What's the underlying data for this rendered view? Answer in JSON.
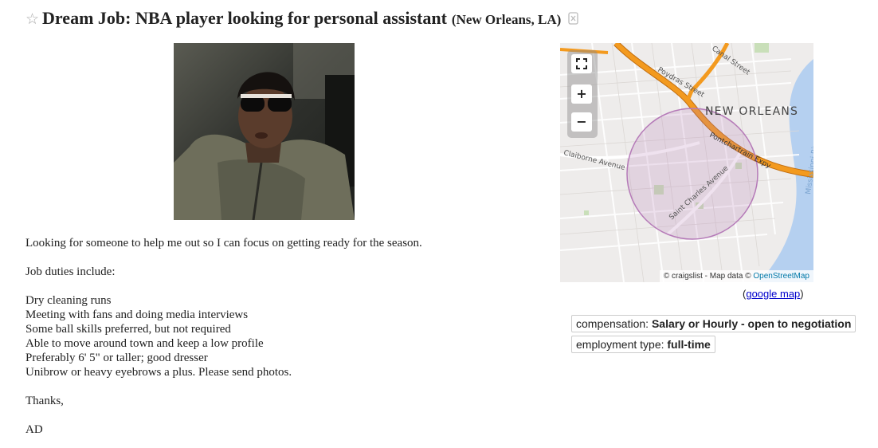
{
  "posting": {
    "star": "☆",
    "title": "Dream Job: NBA player looking for personal assistant",
    "location": "(New Orleans, LA)",
    "hide_icon": "hide-posting-icon"
  },
  "body": {
    "line1": "Looking for someone to help me out so I can focus on getting ready for the season.",
    "line2": "Job duties include:",
    "duties": [
      "Dry cleaning runs",
      "Meeting with fans and doing media interviews",
      "Some ball skills preferred, but not required",
      "Able to move around town and keep a low profile",
      "Preferably 6' 5\" or taller; good dresser",
      "Unibrow or heavy eyebrows a plus. Please send photos."
    ],
    "thanks": "Thanks,",
    "signature": "AD"
  },
  "map": {
    "city": "NEW ORLEANS",
    "streets": {
      "canal": "Canal Street",
      "poydras": "Poydras Street",
      "pontchartrain": "Pontchartrain Expy",
      "claiborne": "Claiborne Avenue",
      "saint_charles": "Saint Charles Avenue",
      "river": "Mississippi River"
    },
    "controls": {
      "fullscreen": "fullscreen-icon",
      "zoom_in": "+",
      "zoom_out": "−"
    },
    "attrib_prefix": "© craigslist - Map data ©",
    "attrib_link": "OpenStreetMap",
    "colors": {
      "highway": "#f39a1f",
      "radius": "#b57ab8",
      "water": "#b5d0f0",
      "land": "#eeeceb",
      "park": "#c9dfb9"
    }
  },
  "google_map": {
    "open": "(",
    "label": "google map",
    "close": ")"
  },
  "attributes": {
    "compensation_label": "compensation:",
    "compensation_value": "Salary or Hourly - open to negotiation",
    "employment_label": "employment type:",
    "employment_value": "full-time"
  }
}
